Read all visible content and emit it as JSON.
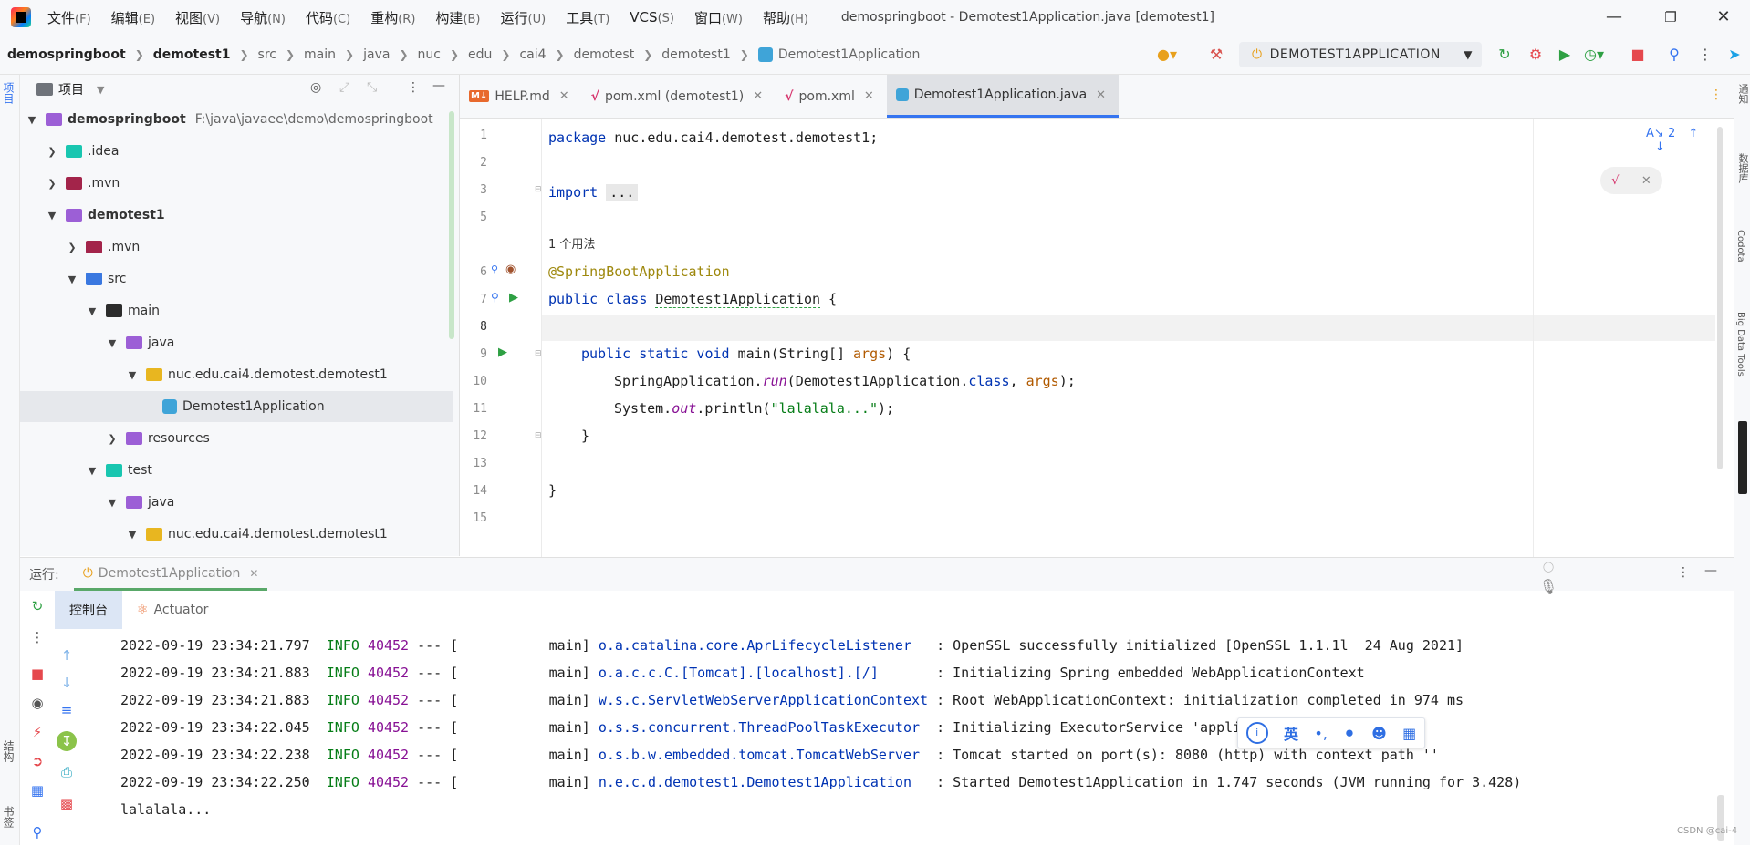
{
  "menubar": {
    "items": [
      {
        "label": "文件",
        "key": "(F)"
      },
      {
        "label": "编辑",
        "key": "(E)"
      },
      {
        "label": "视图",
        "key": "(V)"
      },
      {
        "label": "导航",
        "key": "(N)"
      },
      {
        "label": "代码",
        "key": "(C)"
      },
      {
        "label": "重构",
        "key": "(R)"
      },
      {
        "label": "构建",
        "key": "(B)"
      },
      {
        "label": "运行",
        "key": "(U)"
      },
      {
        "label": "工具",
        "key": "(T)"
      },
      {
        "label": "VCS",
        "key": "(S)"
      },
      {
        "label": "窗口",
        "key": "(W)"
      },
      {
        "label": "帮助",
        "key": "(H)"
      }
    ],
    "window_title": "demospringboot - Demotest1Application.java [demotest1]"
  },
  "navbar": {
    "crumbs": [
      "demospringboot",
      "demotest1",
      "src",
      "main",
      "java",
      "nuc",
      "edu",
      "cai4",
      "demotest",
      "demotest1",
      "Demotest1Application"
    ],
    "run_config": "DEMOTEST1APPLICATION"
  },
  "project": {
    "header": "项目",
    "tree": [
      {
        "label": "demospringboot",
        "path": "F:\\java\\javaee\\demo\\demospringboot",
        "bold": true
      },
      {
        "label": ".idea"
      },
      {
        "label": ".mvn"
      },
      {
        "label": "demotest1",
        "bold": true
      },
      {
        "label": ".mvn"
      },
      {
        "label": "src"
      },
      {
        "label": "main"
      },
      {
        "label": "java"
      },
      {
        "label": "nuc.edu.cai4.demotest.demotest1"
      },
      {
        "label": "Demotest1Application"
      },
      {
        "label": "resources"
      },
      {
        "label": "test"
      },
      {
        "label": "java"
      },
      {
        "label": "nuc.edu.cai4.demotest.demotest1"
      }
    ]
  },
  "editor": {
    "tabs": [
      {
        "label": "HELP.md",
        "icon": "M↓"
      },
      {
        "label": "pom.xml (demotest1)",
        "icon": "m"
      },
      {
        "label": "pom.xml",
        "icon": "m"
      },
      {
        "label": "Demotest1Application.java",
        "icon": "c"
      }
    ],
    "line_numbers": [
      "1",
      "2",
      "3",
      "5",
      "6",
      "7",
      "8",
      "9",
      "10",
      "11",
      "12",
      "13",
      "14",
      "15"
    ],
    "usage_hint": "1 个用法",
    "code": {
      "l1_pkg": "package",
      "l1_rest": " nuc.edu.cai4.demotest.demotest1;",
      "l3_import": "import",
      "l3_fold": "...",
      "l6": "@SpringBootApplication",
      "l7_kw": "public class",
      "l7_cls": "Demotest1Application",
      "l7_brace": " {",
      "l9_kw": "public static void",
      "l9_name": " main(",
      "l9_type": "String",
      "l9_arr": "[] ",
      "l9_args": "args",
      "l9_end": ") {",
      "l10_a": "SpringApplication.",
      "l10_run": "run",
      "l10_b": "(",
      "l10_cls": "Demotest1Application",
      "l10_c": ".",
      "l10_kw": "class",
      "l10_d": ", ",
      "l10_args": "args",
      "l10_e": ");",
      "l11_a": "System.",
      "l11_out": "out",
      "l11_b": ".println(",
      "l11_str": "\"lalalala...\"",
      "l11_c": ");",
      "l12": "}",
      "l14": "}"
    },
    "inspection_count": "2"
  },
  "run": {
    "label": "运行:",
    "config_tab": "Demotest1Application",
    "subtabs": [
      "控制台",
      "Actuator"
    ],
    "logs": [
      {
        "ts": "2022-09-19 23:34:21.797",
        "level": "INFO",
        "pid": "40452",
        "sep": "--- [",
        "thread": "           main]",
        "logger": "o.a.catalina.core.AprLifecycleListener  ",
        "msg": " : OpenSSL successfully initialized [OpenSSL 1.1.1l  24 Aug 2021]"
      },
      {
        "ts": "2022-09-19 23:34:21.883",
        "level": "INFO",
        "pid": "40452",
        "sep": "--- [",
        "thread": "           main]",
        "logger": "o.a.c.c.C.[Tomcat].[localhost].[/]      ",
        "msg": " : Initializing Spring embedded WebApplicationContext"
      },
      {
        "ts": "2022-09-19 23:34:21.883",
        "level": "INFO",
        "pid": "40452",
        "sep": "--- [",
        "thread": "           main]",
        "logger": "w.s.c.ServletWebServerApplicationContext",
        "msg": " : Root WebApplicationContext: initialization completed in 974 ms"
      },
      {
        "ts": "2022-09-19 23:34:22.045",
        "level": "INFO",
        "pid": "40452",
        "sep": "--- [",
        "thread": "           main]",
        "logger": "o.s.s.concurrent.ThreadPoolTaskExecutor ",
        "msg": " : Initializing ExecutorService 'applica"
      },
      {
        "ts": "2022-09-19 23:34:22.238",
        "level": "INFO",
        "pid": "40452",
        "sep": "--- [",
        "thread": "           main]",
        "logger": "o.s.b.w.embedded.tomcat.TomcatWebServer ",
        "msg": " : Tomcat started on port(s): 8080 (http) with context path ''"
      },
      {
        "ts": "2022-09-19 23:34:22.250",
        "level": "INFO",
        "pid": "40452",
        "sep": "--- [",
        "thread": "           main]",
        "logger": "n.e.c.d.demotest1.Demotest1Application  ",
        "msg": " : Started Demotest1Application in 1.747 seconds (JVM running for 3.428)"
      }
    ],
    "output": "lalalala..."
  },
  "ime": {
    "label": "英"
  },
  "right_stripe": [
    "通知",
    "数据库",
    "Codota",
    "Big Data Tools"
  ],
  "left_stripe": [
    "项目",
    "结构",
    "书签"
  ],
  "watermark": "CSDN @cai-4",
  "colors": {
    "accent": "#3574f0",
    "keyword": "#0033b3",
    "string": "#067d17",
    "annotation": "#9e880d",
    "run_green": "#2ea043",
    "stop_red": "#e5484d"
  }
}
